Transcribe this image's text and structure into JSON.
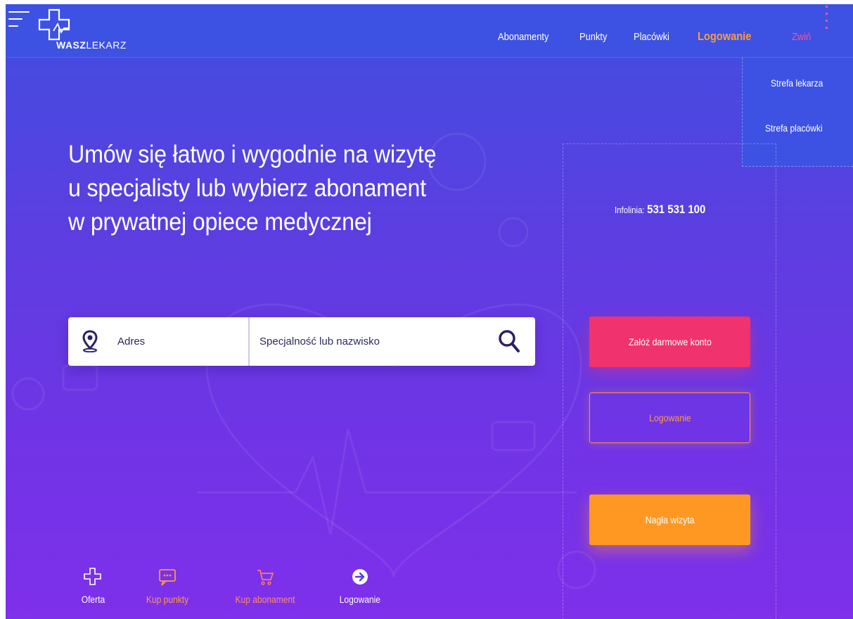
{
  "header": {
    "logo": {
      "part1": "WASZ",
      "part2": "LEKARZ"
    },
    "nav": [
      {
        "label": "Abonamenty"
      },
      {
        "label": "Punkty"
      },
      {
        "label": "Placówki"
      },
      {
        "label": "Logowanie"
      },
      {
        "label": "Zwiń"
      }
    ]
  },
  "dropdown": {
    "items": [
      {
        "label": "Strefa lekarza"
      },
      {
        "label": "Strefa placówki"
      }
    ]
  },
  "hero": {
    "title_lines": [
      "Umów się łatwo i wygodnie na wizytę",
      "u specjalisty lub wybierz abonament",
      "w prywatnej opiece medycznej"
    ]
  },
  "search": {
    "address_placeholder": "Adres",
    "specialty_placeholder": "Specjalność lub nazwisko"
  },
  "side": {
    "infoline_label": "Infolinia:",
    "infoline_number": "531 531 100",
    "register_label": "Załóż darmowe konto",
    "login_label": "Logowanie",
    "urgent_label": "Nagła wizyta"
  },
  "quick_links": [
    {
      "label": "Oferta"
    },
    {
      "label": "Kup punkty"
    },
    {
      "label": "Kup abonament"
    },
    {
      "label": "Logowanie"
    }
  ],
  "colors": {
    "header_bg": "#3d52e2",
    "accent_pink": "#f0326e",
    "accent_orange": "#ff9822",
    "login_orange": "#ff9a3d"
  }
}
